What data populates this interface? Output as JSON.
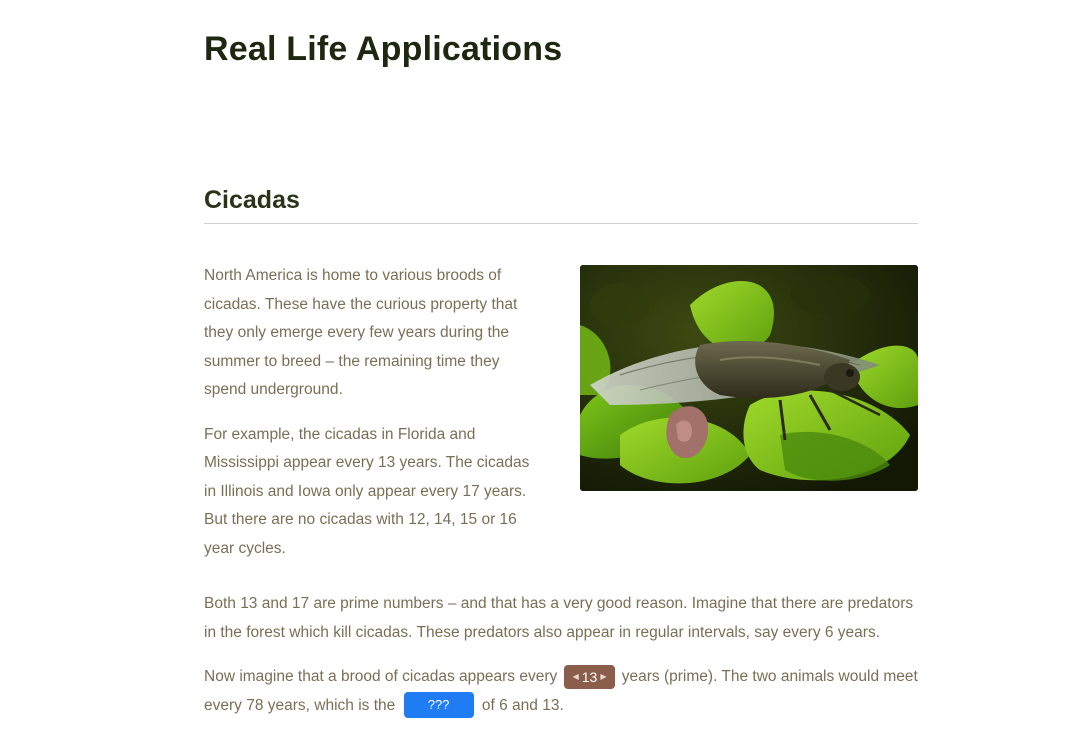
{
  "page": {
    "title": "Real Life Applications"
  },
  "section": {
    "heading": "Cicadas",
    "intro_paragraphs": [
      "North America is home to various broods of cicadas. These have the curious property that they only emerge every few years during the summer to breed – the remaining time they spend underground.",
      "For example, the cicadas in Florida and Mississippi appear every 13 years. The cicadas in Illinois and Iowa only appear every 17 years. But there are no cicadas with 12, 14, 15 or 16 year cycles."
    ],
    "paragraph_primes": "Both 13 and 17 are prime numbers – and that has a very good reason. Imagine that there are predators in the forest which kill cicadas. These predators also appear in regular intervals, say every 6 years.",
    "paragraph_brood": {
      "before_stepper": "Now imagine that a brood of cicadas appears every",
      "stepper_value": "13",
      "after_stepper": "years (prime). The two animals would meet every 78 years, which is the",
      "blank_value": "???",
      "after_blank": "of 6 and 13."
    }
  },
  "colors": {
    "heading": "#1e2710",
    "body_text": "#7a6f55",
    "stepper_bg": "#8b5d4b",
    "blank_bg": "#1f7cf3"
  },
  "icons": {
    "stepper_left": "caret-left-icon",
    "stepper_right": "caret-right-icon"
  }
}
